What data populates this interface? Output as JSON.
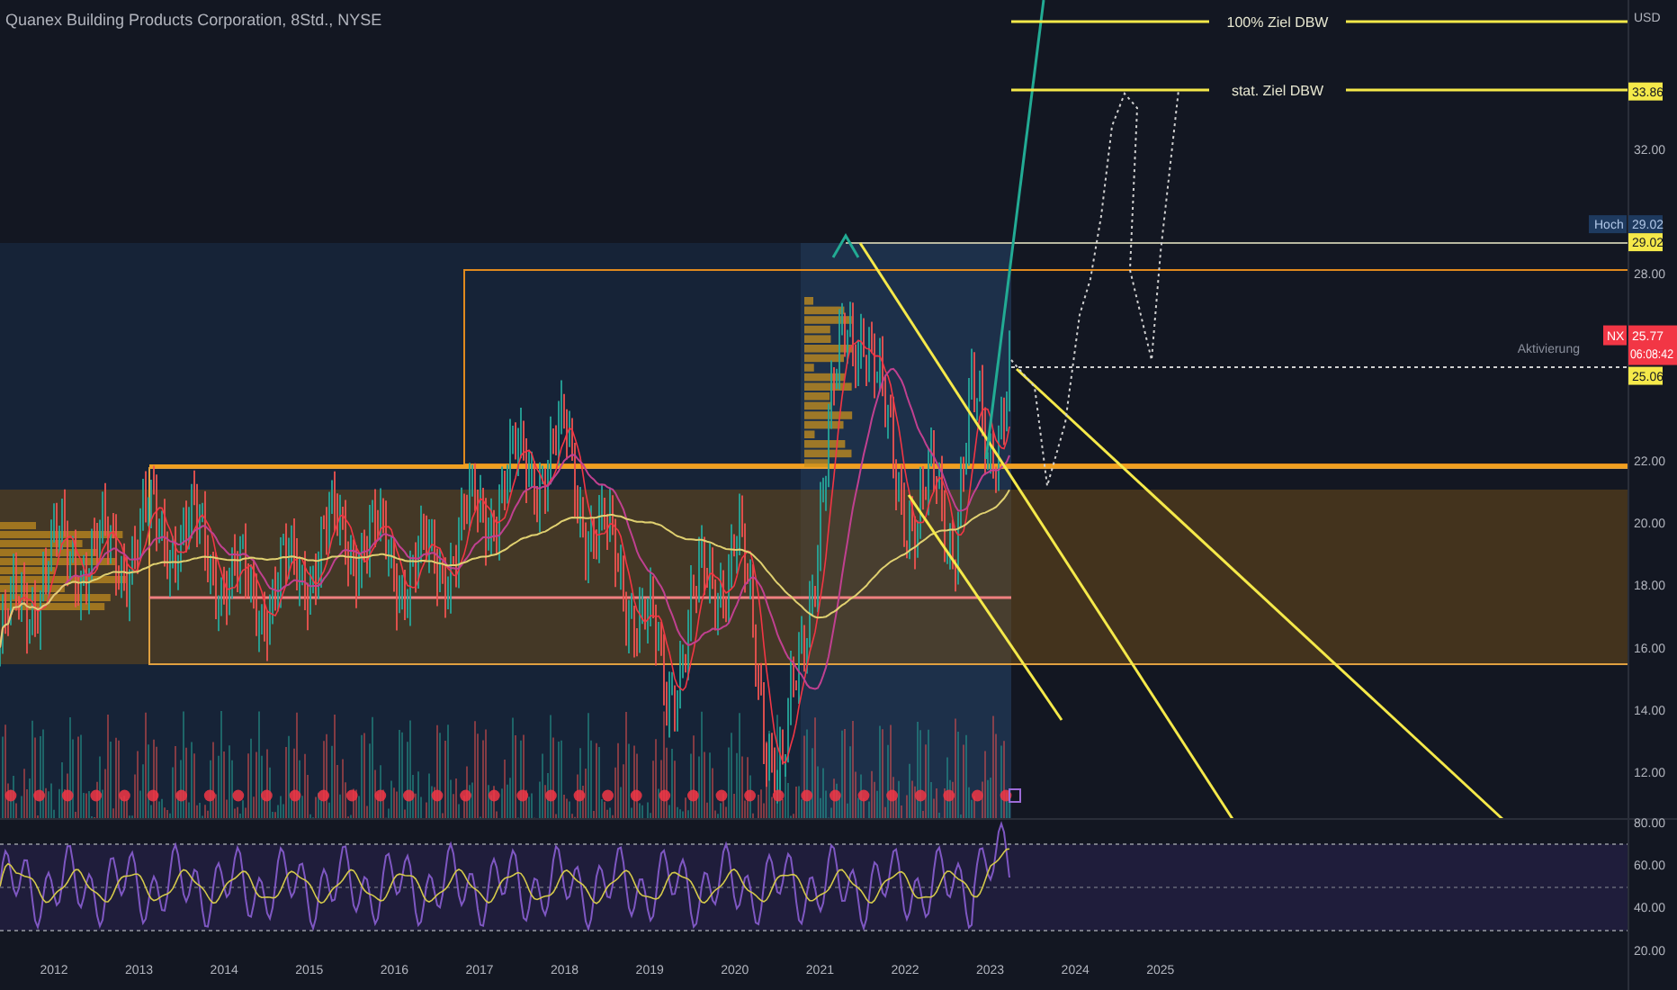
{
  "title": "Quanex Building Products Corporation, 8Std., NYSE",
  "currency": "USD",
  "target_lines": [
    {
      "label": "100% Ziel DBW"
    },
    {
      "label": "stat. Ziel DBW"
    }
  ],
  "price_axis": {
    "labels": [
      "32.00",
      "28.00",
      "22.00",
      "20.00",
      "18.00",
      "16.00",
      "14.00",
      "12.00"
    ]
  },
  "price_tags": [
    {
      "kind": "target",
      "text": "33.86"
    },
    {
      "kind": "high",
      "label": "Hoch",
      "text": "29.02"
    },
    {
      "kind": "target",
      "text": "29.02"
    },
    {
      "kind": "last",
      "label": "NX",
      "text": "25.77",
      "countdown": "06:08:42",
      "note": "Aktivierung"
    },
    {
      "kind": "target",
      "text": "25.06"
    }
  ],
  "rsi_axis": {
    "labels": [
      "80.00",
      "60.00",
      "40.00",
      "20.00"
    ]
  },
  "time_axis": {
    "labels": [
      "2012",
      "2013",
      "2014",
      "2015",
      "2016",
      "2017",
      "2018",
      "2019",
      "2020",
      "2021",
      "2022",
      "2023",
      "2024",
      "2025"
    ]
  }
}
